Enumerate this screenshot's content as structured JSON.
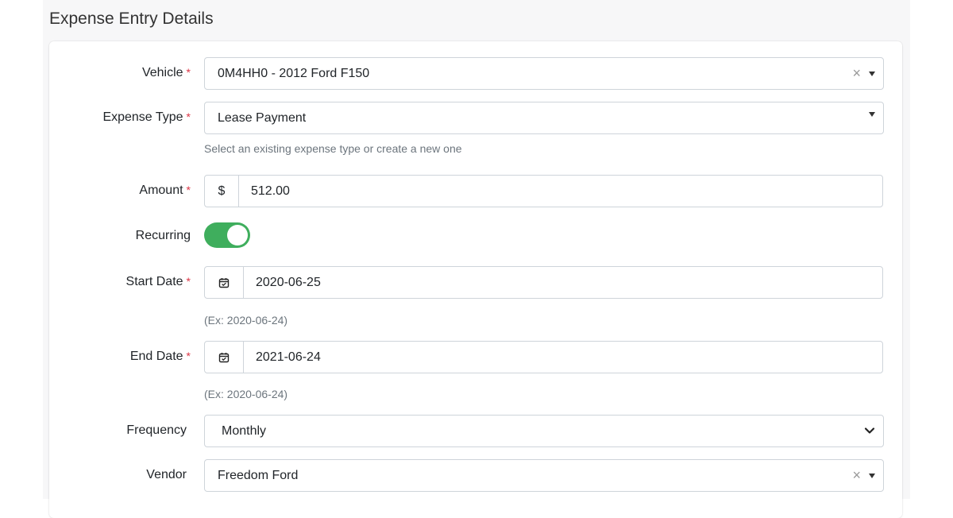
{
  "section_title": "Expense Entry Details",
  "required_mark": "*",
  "fields": {
    "vehicle": {
      "label": "Vehicle",
      "value": "0M4HH0 - 2012 Ford F150",
      "clear": "×"
    },
    "expense_type": {
      "label": "Expense Type",
      "value": "Lease Payment",
      "help": "Select an existing expense type or create a new one"
    },
    "amount": {
      "label": "Amount",
      "prefix": "$",
      "value": "512.00"
    },
    "recurring": {
      "label": "Recurring",
      "on": true
    },
    "start_date": {
      "label": "Start Date",
      "value": "2020-06-25",
      "help": "(Ex: 2020-06-24)"
    },
    "end_date": {
      "label": "End Date",
      "value": "2021-06-24",
      "help": "(Ex: 2020-06-24)"
    },
    "frequency": {
      "label": "Frequency",
      "value": "Monthly"
    },
    "vendor": {
      "label": "Vendor",
      "value": "Freedom Ford",
      "clear": "×"
    }
  },
  "colors": {
    "toggle_on": "#3fae5d",
    "required": "#dc3545"
  },
  "icons": {
    "date": "calendar-check-icon",
    "dropdown": "caret-down-icon",
    "select": "chevron-down-icon",
    "clear": "close-icon"
  }
}
